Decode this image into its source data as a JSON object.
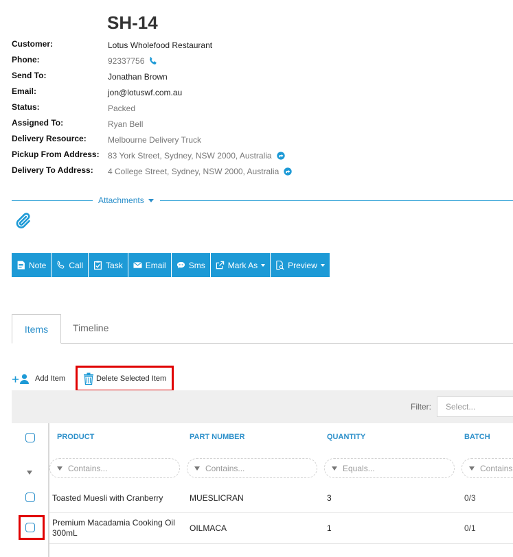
{
  "record": {
    "title": "SH-14"
  },
  "fields": [
    {
      "label": "Customer:",
      "value": "Lotus Wholefood Restaurant"
    },
    {
      "label": "Phone:",
      "value": "92337756"
    },
    {
      "label": "Send To:",
      "value": "Jonathan Brown"
    },
    {
      "label": "Email:",
      "value": "jon@lotuswf.com.au"
    },
    {
      "label": "Status:",
      "value": "Packed"
    },
    {
      "label": "Assigned To:",
      "value": "Ryan Bell"
    },
    {
      "label": "Delivery Resource:",
      "value": "Melbourne Delivery Truck"
    },
    {
      "label": "Pickup From Address:",
      "value": "83 York Street, Sydney, NSW 2000, Australia"
    },
    {
      "label": "Delivery To Address:",
      "value": "4 College Street, Sydney, NSW 2000, Australia"
    }
  ],
  "attachments": {
    "label": "Attachments"
  },
  "toolbar": {
    "note": "Note",
    "call": "Call",
    "task": "Task",
    "email": "Email",
    "sms": "Sms",
    "mark_as": "Mark As",
    "preview": "Preview"
  },
  "tabs": {
    "items": "Items",
    "timeline": "Timeline"
  },
  "actions": {
    "add_item": "Add Item",
    "delete_selected": "Delete Selected Item"
  },
  "filter": {
    "label": "Filter:",
    "placeholder": "Select..."
  },
  "grid": {
    "columns": [
      "PRODUCT",
      "PART NUMBER",
      "QUANTITY",
      "BATCH"
    ],
    "filters": [
      "Contains...",
      "Contains...",
      "Equals...",
      "Contains"
    ],
    "rows": [
      {
        "product": "Toasted Muesli with Cranberry",
        "part": "MUESLICRAN",
        "qty": "3",
        "batch": "0/3"
      },
      {
        "product": "Premium Macadamia Cooking Oil 300mL",
        "part": "OILMACA",
        "qty": "1",
        "batch": "0/1"
      }
    ]
  },
  "colors": {
    "accent": "#1d9ad6",
    "highlight": "#e00000"
  }
}
